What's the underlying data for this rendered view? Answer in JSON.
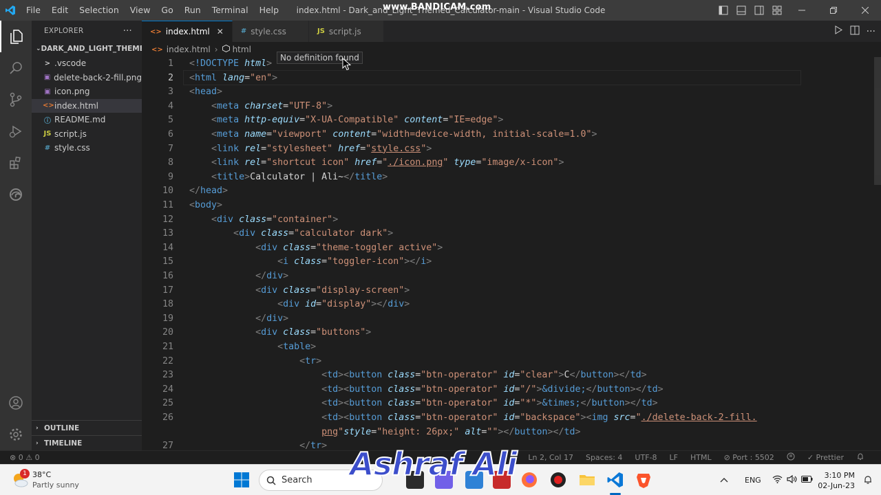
{
  "titlebar": {
    "menu": [
      "File",
      "Edit",
      "Selection",
      "View",
      "Go",
      "Run",
      "Terminal",
      "Help"
    ],
    "window_title": "index.html - Dark_and_Light_Themed_Calculator-main - Visual Studio Code",
    "recorder_watermark": "www.BANDICAM.com"
  },
  "sidebar": {
    "header": "EXPLORER",
    "more": "···",
    "folder": "DARK_AND_LIGHT_THEME...",
    "files": [
      {
        "name": ".vscode",
        "icon": ">",
        "icon_color": "#cccccc"
      },
      {
        "name": "delete-back-2-fill.png",
        "icon": "▣",
        "icon_color": "#a074c4"
      },
      {
        "name": "icon.png",
        "icon": "▣",
        "icon_color": "#a074c4"
      },
      {
        "name": "index.html",
        "icon": "<>",
        "icon_color": "#e37933"
      },
      {
        "name": "README.md",
        "icon": "ⓘ",
        "icon_color": "#519aba"
      },
      {
        "name": "script.js",
        "icon": "JS",
        "icon_color": "#cbcb41"
      },
      {
        "name": "style.css",
        "icon": "#",
        "icon_color": "#519aba"
      }
    ],
    "outline": "OUTLINE",
    "timeline": "TIMELINE"
  },
  "tabs": [
    {
      "label": "index.html",
      "icon": "<>",
      "icon_color": "#e37933",
      "active": true
    },
    {
      "label": "style.css",
      "icon": "#",
      "icon_color": "#519aba",
      "active": false
    },
    {
      "label": "script.js",
      "icon": "JS",
      "icon_color": "#cbcb41",
      "active": false
    }
  ],
  "breadcrumb": {
    "file": "index.html",
    "node": "html"
  },
  "tooltip": "No definition found",
  "editor": {
    "current_line": 2,
    "lines": [
      {
        "n": "1",
        "parts": [
          [
            "punc",
            "<"
          ],
          [
            "tag",
            "!DOCTYPE "
          ],
          [
            "attr",
            "html"
          ],
          [
            "punc",
            ">"
          ]
        ]
      },
      {
        "n": "2",
        "parts": [
          [
            "punc",
            "<"
          ],
          [
            "tag",
            "html "
          ],
          [
            "attr",
            "lang"
          ],
          [
            "txt",
            "="
          ],
          [
            "str",
            "\"en\""
          ],
          [
            "punc",
            ">"
          ]
        ]
      },
      {
        "n": "3",
        "parts": [
          [
            "punc",
            "<"
          ],
          [
            "tag",
            "head"
          ],
          [
            "punc",
            ">"
          ]
        ]
      },
      {
        "n": "4",
        "parts": [
          [
            "txt",
            "    "
          ],
          [
            "punc",
            "<"
          ],
          [
            "tag",
            "meta "
          ],
          [
            "attr",
            "charset"
          ],
          [
            "txt",
            "="
          ],
          [
            "str",
            "\"UTF-8\""
          ],
          [
            "punc",
            ">"
          ]
        ]
      },
      {
        "n": "5",
        "parts": [
          [
            "txt",
            "    "
          ],
          [
            "punc",
            "<"
          ],
          [
            "tag",
            "meta "
          ],
          [
            "attr",
            "http-equiv"
          ],
          [
            "txt",
            "="
          ],
          [
            "str",
            "\"X-UA-Compatible\" "
          ],
          [
            "attr",
            "content"
          ],
          [
            "txt",
            "="
          ],
          [
            "str",
            "\"IE=edge\""
          ],
          [
            "punc",
            ">"
          ]
        ]
      },
      {
        "n": "6",
        "parts": [
          [
            "txt",
            "    "
          ],
          [
            "punc",
            "<"
          ],
          [
            "tag",
            "meta "
          ],
          [
            "attr",
            "name"
          ],
          [
            "txt",
            "="
          ],
          [
            "str",
            "\"viewport\" "
          ],
          [
            "attr",
            "content"
          ],
          [
            "txt",
            "="
          ],
          [
            "str",
            "\"width=device-width, initial-scale=1.0\""
          ],
          [
            "punc",
            ">"
          ]
        ]
      },
      {
        "n": "7",
        "parts": [
          [
            "txt",
            "    "
          ],
          [
            "punc",
            "<"
          ],
          [
            "tag",
            "link "
          ],
          [
            "attr",
            "rel"
          ],
          [
            "txt",
            "="
          ],
          [
            "str",
            "\"stylesheet\" "
          ],
          [
            "attr",
            "href"
          ],
          [
            "txt",
            "="
          ],
          [
            "str",
            "\""
          ],
          [
            "link",
            "style.css"
          ],
          [
            "str",
            "\""
          ],
          [
            "punc",
            ">"
          ]
        ]
      },
      {
        "n": "8",
        "parts": [
          [
            "txt",
            "    "
          ],
          [
            "punc",
            "<"
          ],
          [
            "tag",
            "link "
          ],
          [
            "attr",
            "rel"
          ],
          [
            "txt",
            "="
          ],
          [
            "str",
            "\"shortcut icon\" "
          ],
          [
            "attr",
            "href"
          ],
          [
            "txt",
            "="
          ],
          [
            "str",
            "\""
          ],
          [
            "link",
            "./icon.png"
          ],
          [
            "str",
            "\" "
          ],
          [
            "attr",
            "type"
          ],
          [
            "txt",
            "="
          ],
          [
            "str",
            "\"image/x-icon\""
          ],
          [
            "punc",
            ">"
          ]
        ]
      },
      {
        "n": "9",
        "parts": [
          [
            "txt",
            "    "
          ],
          [
            "punc",
            "<"
          ],
          [
            "tag",
            "title"
          ],
          [
            "punc",
            ">"
          ],
          [
            "txt",
            "Calculator | Ali~"
          ],
          [
            "punc",
            "</"
          ],
          [
            "tag",
            "title"
          ],
          [
            "punc",
            ">"
          ]
        ]
      },
      {
        "n": "10",
        "parts": [
          [
            "punc",
            "</"
          ],
          [
            "tag",
            "head"
          ],
          [
            "punc",
            ">"
          ]
        ]
      },
      {
        "n": "11",
        "parts": [
          [
            "punc",
            "<"
          ],
          [
            "tag",
            "body"
          ],
          [
            "punc",
            ">"
          ]
        ]
      },
      {
        "n": "12",
        "parts": [
          [
            "txt",
            "    "
          ],
          [
            "punc",
            "<"
          ],
          [
            "tag",
            "div "
          ],
          [
            "attr",
            "class"
          ],
          [
            "txt",
            "="
          ],
          [
            "str",
            "\"container\""
          ],
          [
            "punc",
            ">"
          ]
        ]
      },
      {
        "n": "13",
        "parts": [
          [
            "txt",
            "        "
          ],
          [
            "punc",
            "<"
          ],
          [
            "tag",
            "div "
          ],
          [
            "attr",
            "class"
          ],
          [
            "txt",
            "="
          ],
          [
            "str",
            "\"calculator dark\""
          ],
          [
            "punc",
            ">"
          ]
        ]
      },
      {
        "n": "14",
        "parts": [
          [
            "txt",
            "            "
          ],
          [
            "punc",
            "<"
          ],
          [
            "tag",
            "div "
          ],
          [
            "attr",
            "class"
          ],
          [
            "txt",
            "="
          ],
          [
            "str",
            "\"theme-toggler active\""
          ],
          [
            "punc",
            ">"
          ]
        ]
      },
      {
        "n": "15",
        "parts": [
          [
            "txt",
            "                "
          ],
          [
            "punc",
            "<"
          ],
          [
            "tag",
            "i "
          ],
          [
            "attr",
            "class"
          ],
          [
            "txt",
            "="
          ],
          [
            "str",
            "\"toggler-icon\""
          ],
          [
            "punc",
            "></"
          ],
          [
            "tag",
            "i"
          ],
          [
            "punc",
            ">"
          ]
        ]
      },
      {
        "n": "16",
        "parts": [
          [
            "txt",
            "            "
          ],
          [
            "punc",
            "</"
          ],
          [
            "tag",
            "div"
          ],
          [
            "punc",
            ">"
          ]
        ]
      },
      {
        "n": "17",
        "parts": [
          [
            "txt",
            "            "
          ],
          [
            "punc",
            "<"
          ],
          [
            "tag",
            "div "
          ],
          [
            "attr",
            "class"
          ],
          [
            "txt",
            "="
          ],
          [
            "str",
            "\"display-screen\""
          ],
          [
            "punc",
            ">"
          ]
        ]
      },
      {
        "n": "18",
        "parts": [
          [
            "txt",
            "                "
          ],
          [
            "punc",
            "<"
          ],
          [
            "tag",
            "div "
          ],
          [
            "attr",
            "id"
          ],
          [
            "txt",
            "="
          ],
          [
            "str",
            "\"display\""
          ],
          [
            "punc",
            "></"
          ],
          [
            "tag",
            "div"
          ],
          [
            "punc",
            ">"
          ]
        ]
      },
      {
        "n": "19",
        "parts": [
          [
            "txt",
            "            "
          ],
          [
            "punc",
            "</"
          ],
          [
            "tag",
            "div"
          ],
          [
            "punc",
            ">"
          ]
        ]
      },
      {
        "n": "20",
        "parts": [
          [
            "txt",
            "            "
          ],
          [
            "punc",
            "<"
          ],
          [
            "tag",
            "div "
          ],
          [
            "attr",
            "class"
          ],
          [
            "txt",
            "="
          ],
          [
            "str",
            "\"buttons\""
          ],
          [
            "punc",
            ">"
          ]
        ]
      },
      {
        "n": "21",
        "parts": [
          [
            "txt",
            "                "
          ],
          [
            "punc",
            "<"
          ],
          [
            "tag",
            "table"
          ],
          [
            "punc",
            ">"
          ]
        ]
      },
      {
        "n": "22",
        "parts": [
          [
            "txt",
            "                    "
          ],
          [
            "punc",
            "<"
          ],
          [
            "tag",
            "tr"
          ],
          [
            "punc",
            ">"
          ]
        ]
      },
      {
        "n": "23",
        "parts": [
          [
            "txt",
            "                        "
          ],
          [
            "punc",
            "<"
          ],
          [
            "tag",
            "td"
          ],
          [
            "punc",
            "><"
          ],
          [
            "tag",
            "button "
          ],
          [
            "attr",
            "class"
          ],
          [
            "txt",
            "="
          ],
          [
            "str",
            "\"btn-operator\" "
          ],
          [
            "attr",
            "id"
          ],
          [
            "txt",
            "="
          ],
          [
            "str",
            "\"clear\""
          ],
          [
            "punc",
            ">"
          ],
          [
            "txt",
            "C"
          ],
          [
            "punc",
            "</"
          ],
          [
            "tag",
            "button"
          ],
          [
            "punc",
            "></"
          ],
          [
            "tag",
            "td"
          ],
          [
            "punc",
            ">"
          ]
        ]
      },
      {
        "n": "24",
        "parts": [
          [
            "txt",
            "                        "
          ],
          [
            "punc",
            "<"
          ],
          [
            "tag",
            "td"
          ],
          [
            "punc",
            "><"
          ],
          [
            "tag",
            "button "
          ],
          [
            "attr",
            "class"
          ],
          [
            "txt",
            "="
          ],
          [
            "str",
            "\"btn-operator\" "
          ],
          [
            "attr",
            "id"
          ],
          [
            "txt",
            "="
          ],
          [
            "str",
            "\"/\""
          ],
          [
            "punc",
            ">"
          ],
          [
            "ent",
            "&divide;"
          ],
          [
            "punc",
            "</"
          ],
          [
            "tag",
            "button"
          ],
          [
            "punc",
            "></"
          ],
          [
            "tag",
            "td"
          ],
          [
            "punc",
            ">"
          ]
        ]
      },
      {
        "n": "25",
        "parts": [
          [
            "txt",
            "                        "
          ],
          [
            "punc",
            "<"
          ],
          [
            "tag",
            "td"
          ],
          [
            "punc",
            "><"
          ],
          [
            "tag",
            "button "
          ],
          [
            "attr",
            "class"
          ],
          [
            "txt",
            "="
          ],
          [
            "str",
            "\"btn-operator\" "
          ],
          [
            "attr",
            "id"
          ],
          [
            "txt",
            "="
          ],
          [
            "str",
            "\"*\""
          ],
          [
            "punc",
            ">"
          ],
          [
            "ent",
            "&times;"
          ],
          [
            "punc",
            "</"
          ],
          [
            "tag",
            "button"
          ],
          [
            "punc",
            "></"
          ],
          [
            "tag",
            "td"
          ],
          [
            "punc",
            ">"
          ]
        ]
      },
      {
        "n": "26",
        "parts": [
          [
            "txt",
            "                        "
          ],
          [
            "punc",
            "<"
          ],
          [
            "tag",
            "td"
          ],
          [
            "punc",
            "><"
          ],
          [
            "tag",
            "button "
          ],
          [
            "attr",
            "class"
          ],
          [
            "txt",
            "="
          ],
          [
            "str",
            "\"btn-operator\" "
          ],
          [
            "attr",
            "id"
          ],
          [
            "txt",
            "="
          ],
          [
            "str",
            "\"backspace\""
          ],
          [
            "punc",
            "><"
          ],
          [
            "tag",
            "img "
          ],
          [
            "attr",
            "src"
          ],
          [
            "txt",
            "="
          ],
          [
            "str",
            "\""
          ],
          [
            "link",
            "./delete-back-2-fill."
          ]
        ]
      },
      {
        "n": "",
        "parts": [
          [
            "txt",
            "                        "
          ],
          [
            "link",
            "png"
          ],
          [
            "str",
            "\""
          ],
          [
            "attr",
            "style"
          ],
          [
            "txt",
            "="
          ],
          [
            "str",
            "\"height: 26px;\" "
          ],
          [
            "attr",
            "alt"
          ],
          [
            "txt",
            "="
          ],
          [
            "str",
            "\"\""
          ],
          [
            "punc",
            "></"
          ],
          [
            "tag",
            "button"
          ],
          [
            "punc",
            "></"
          ],
          [
            "tag",
            "td"
          ],
          [
            "punc",
            ">"
          ]
        ]
      },
      {
        "n": "27",
        "parts": [
          [
            "txt",
            "                    "
          ],
          [
            "punc",
            "</"
          ],
          [
            "tag",
            "tr"
          ],
          [
            "punc",
            ">"
          ]
        ]
      }
    ]
  },
  "statusbar": {
    "errors": "⊗ 0 ⚠ 0",
    "position": "Ln 2, Col 17",
    "spaces": "Spaces: 4",
    "encoding": "UTF-8",
    "eol": "LF",
    "language": "HTML",
    "port": "⊘ Port : 5502",
    "prettier": "✓ Prettier"
  },
  "taskbar": {
    "weather_temp": "38°C",
    "weather_desc": "Partly sunny",
    "weather_badge": "1",
    "search_placeholder": "Search",
    "tray_lang": "ENG",
    "time": "3:10 PM",
    "date": "02-Jun-23"
  },
  "overlay_name": "Ashraf Ali"
}
